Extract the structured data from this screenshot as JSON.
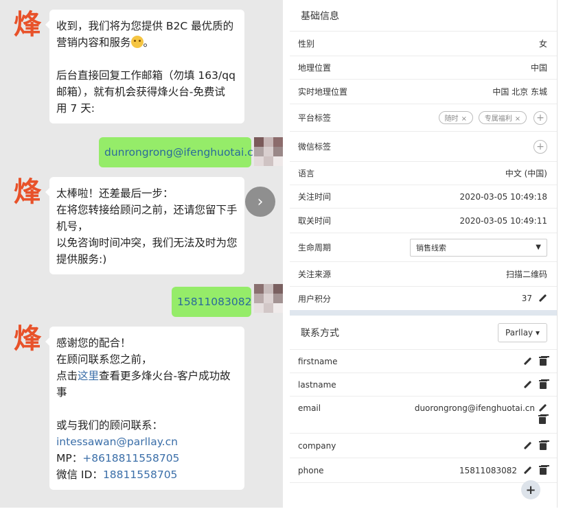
{
  "avatar": {
    "glyph": "烽"
  },
  "chat": {
    "msg1": {
      "lines1": [
        "收到，我们将为您提供 B2C 最优质的",
        "营销内容和服务"
      ],
      "lines2": [
        "后台直接回复工作邮箱（勿填 163/qq",
        "邮箱），就有机会获得烽火台-免费试",
        "用 7 天:"
      ]
    },
    "reply1": "dunrongrong@ifenghuotai.cn",
    "msg2": {
      "lines": [
        "太棒啦！还差最后一步：",
        "在将您转接给顾问之前，还请您留下手",
        "机号，",
        "以免咨询时间冲突，我们无法及时为您",
        "提供服务:)"
      ]
    },
    "reply2": "15811083082",
    "msg3": {
      "line1": "感谢您的配合！",
      "line2": "在顾问联系您之前，",
      "line3_pre": "点击",
      "line3_link": "这里",
      "line3_post": "查看更多烽火台-客户成功故",
      "line4": "事",
      "line5": "或与我们的顾问联系：",
      "email": "intessawan@parllay.cn",
      "mp_label": "MP：",
      "mp_value": "+8618811558705",
      "wechat_label": "微信 ID：",
      "wechat_value": "18811558705"
    },
    "nav_next_glyph": "›"
  },
  "basic": {
    "title": "基础信息",
    "gender": {
      "label": "性别",
      "value": "女"
    },
    "location": {
      "label": "地理位置",
      "value": "中国"
    },
    "realtime_location": {
      "label": "实时地理位置",
      "value": "中国 北京 东城"
    },
    "platform_tags": {
      "label": "平台标签",
      "tags": [
        "随时",
        "专属福利"
      ],
      "remove": "×",
      "add": "+"
    },
    "wechat_tags": {
      "label": "微信标签",
      "add": "+"
    },
    "language": {
      "label": "语言",
      "value": "中文 (中国)"
    },
    "follow_time": {
      "label": "关注时间",
      "value": "2020-03-05 10:49:18"
    },
    "unfollow_time": {
      "label": "取关时间",
      "value": "2020-03-05 10:49:11"
    },
    "lifecycle": {
      "label": "生命周期",
      "value": "销售线索",
      "arrow": "▼"
    },
    "source": {
      "label": "关注来源",
      "value": "扫描二维码"
    },
    "points": {
      "label": "用户积分",
      "value": "37"
    }
  },
  "contact": {
    "title": "联系方式",
    "dropdown": "Parllay ▾",
    "fields": [
      {
        "label": "firstname",
        "value": ""
      },
      {
        "label": "lastname",
        "value": ""
      },
      {
        "label": "email",
        "value": "duorongrong@ifenghuotai.cn"
      },
      {
        "label": "company",
        "value": ""
      },
      {
        "label": "phone",
        "value": "15811083082"
      }
    ],
    "add": "+"
  }
}
